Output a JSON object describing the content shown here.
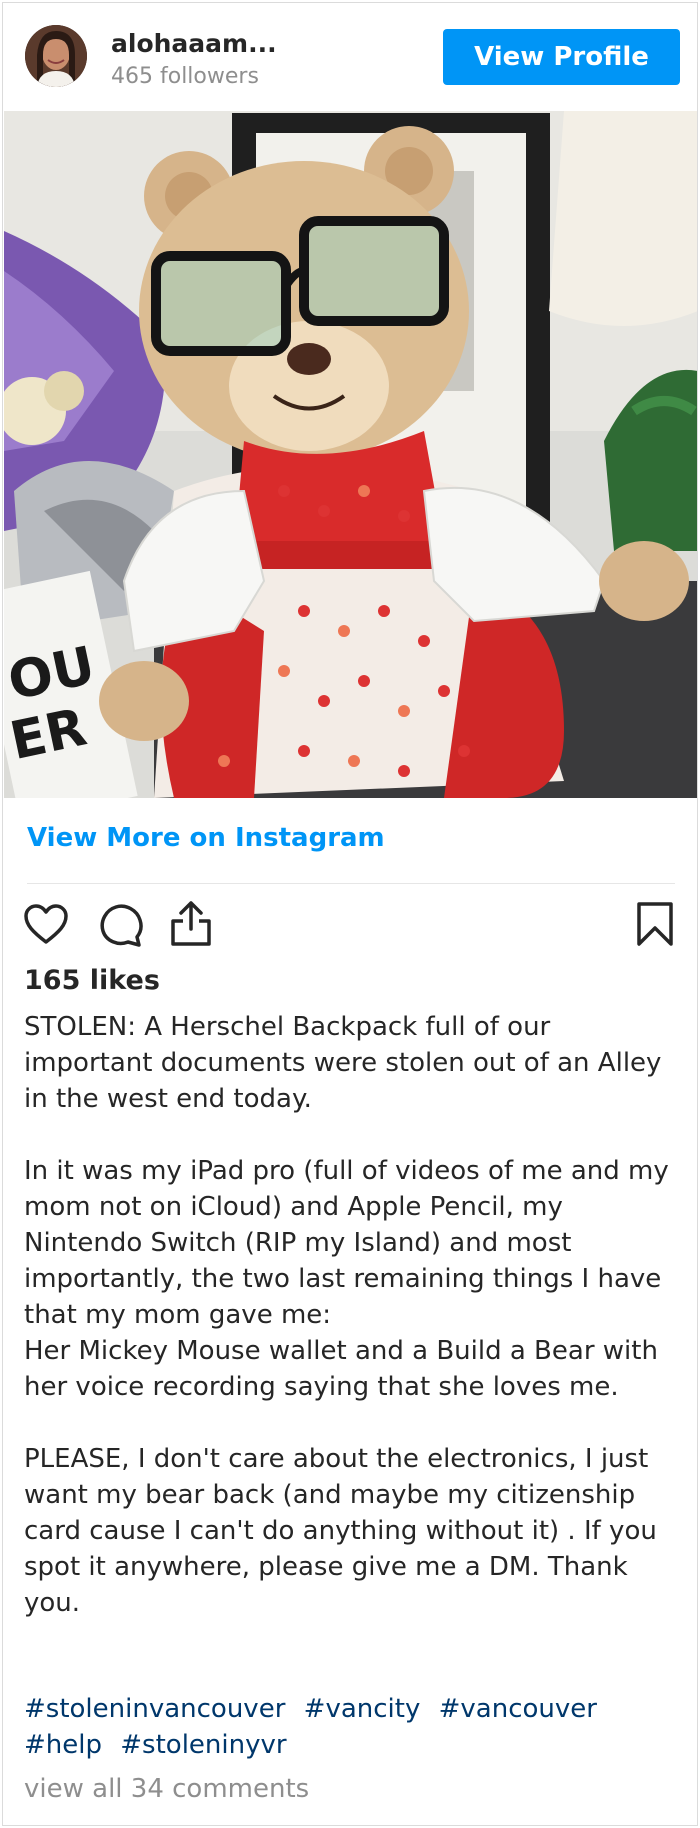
{
  "profile": {
    "username": "alohaaam...",
    "followers": "465 followers",
    "view_profile_label": "View Profile"
  },
  "post": {
    "image_alt": "Teddy bear wearing glasses, a white jacket and a red apple-print dress",
    "view_more_label": "View More on Instagram",
    "likes": "165 likes",
    "caption": "STOLEN: A Herschel Backpack full of our important documents were stolen out of an Alley in the west end today.\n\nIn it was my iPad pro (full of videos of me and my mom not on iCloud) and Apple Pencil, my Nintendo Switch (RIP my Island) and most importantly, the two last remaining things I have that my mom gave me:\nHer Mickey Mouse wallet and a Build a Bear with her voice recording saying that she loves me.\n\nPLEASE, I don't care about the electronics, I just want my bear back (and maybe my citizenship card cause I can't do anything without it) . If you spot it anywhere, please give me a DM. Thank you.",
    "hashtags": [
      "#stoleninvancouver",
      "#vancity",
      "#vancouver",
      "#help",
      "#stoleninyvr"
    ],
    "comments_link": "view all 34 comments"
  },
  "icons": {
    "like": "heart-icon",
    "comment": "comment-icon",
    "share": "share-icon",
    "save": "bookmark-icon"
  },
  "colors": {
    "accent": "#0095f6",
    "hashtag": "#00376b",
    "muted": "#8e8e8e"
  }
}
